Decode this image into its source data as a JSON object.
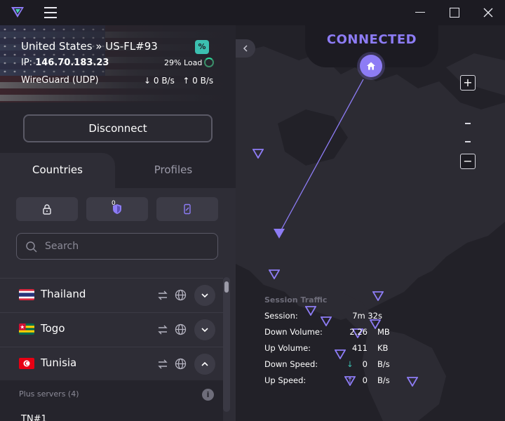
{
  "server": {
    "name": "United States » US-FL#93",
    "ip_label": "IP:",
    "ip": "146.70.183.23",
    "protocol": "WireGuard (UDP)",
    "load": "29% Load",
    "download": "↓ 0 B/s",
    "upload": "↑ 0 B/s",
    "badge": "%"
  },
  "disconnect_label": "Disconnect",
  "tabs": {
    "countries": "Countries",
    "profiles": "Profiles"
  },
  "filters": {
    "p2p_badge": "0"
  },
  "search": {
    "placeholder": "Search"
  },
  "countries": [
    {
      "name": "Thailand"
    },
    {
      "name": "Togo"
    },
    {
      "name": "Tunisia"
    }
  ],
  "plus_servers": {
    "label": "Plus servers (4)",
    "first": "TN#1"
  },
  "status": {
    "connected": "CONNECTED"
  },
  "session_traffic": {
    "title": "Session Traffic",
    "rows": [
      {
        "label": "Session:",
        "value": "7m 32s",
        "unit": ""
      },
      {
        "label": "Down Volume:",
        "value": "2.26",
        "unit": "MB"
      },
      {
        "label": "Up Volume:",
        "value": "411",
        "unit": "KB"
      },
      {
        "label": "Down Speed:",
        "value": "0",
        "unit": "B/s"
      },
      {
        "label": "Up Speed:",
        "value": "0",
        "unit": "B/s"
      }
    ]
  },
  "colors": {
    "accent": "#8d7cf5",
    "background": "#1c1b22",
    "panel": "#2e2d36"
  }
}
